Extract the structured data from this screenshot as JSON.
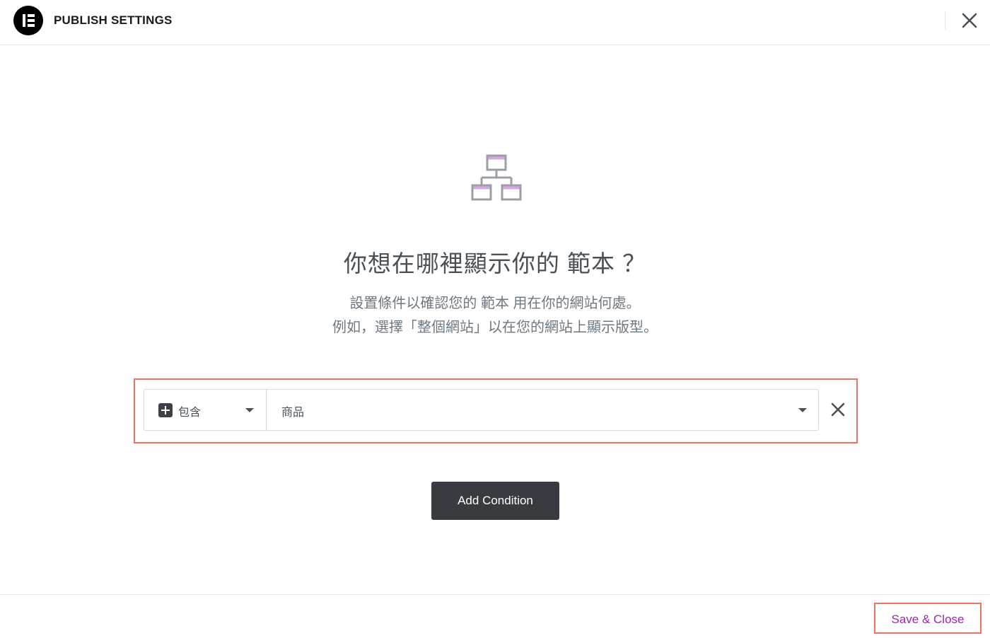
{
  "header": {
    "title": "PUBLISH SETTINGS"
  },
  "main": {
    "title": "你想在哪裡顯示你的 範本 ？",
    "description_line1": "設置條件以確認您的 範本 用在你的網站何處。",
    "description_line2": "例如，選擇「整個網站」以在您的網站上顯示版型。"
  },
  "condition": {
    "type_label": "包含",
    "value_label": "商品"
  },
  "actions": {
    "add_condition_label": "Add Condition",
    "save_close_label": "Save & Close"
  },
  "colors": {
    "accent": "#9b27af",
    "highlight": "#e8756a",
    "dark_button": "#383c40"
  },
  "icons": {
    "logo": "elementor-logo-icon",
    "close": "close-icon",
    "hero": "site-hierarchy-icon",
    "plus": "plus-icon",
    "caret": "caret-down-icon",
    "remove": "remove-condition-icon"
  }
}
